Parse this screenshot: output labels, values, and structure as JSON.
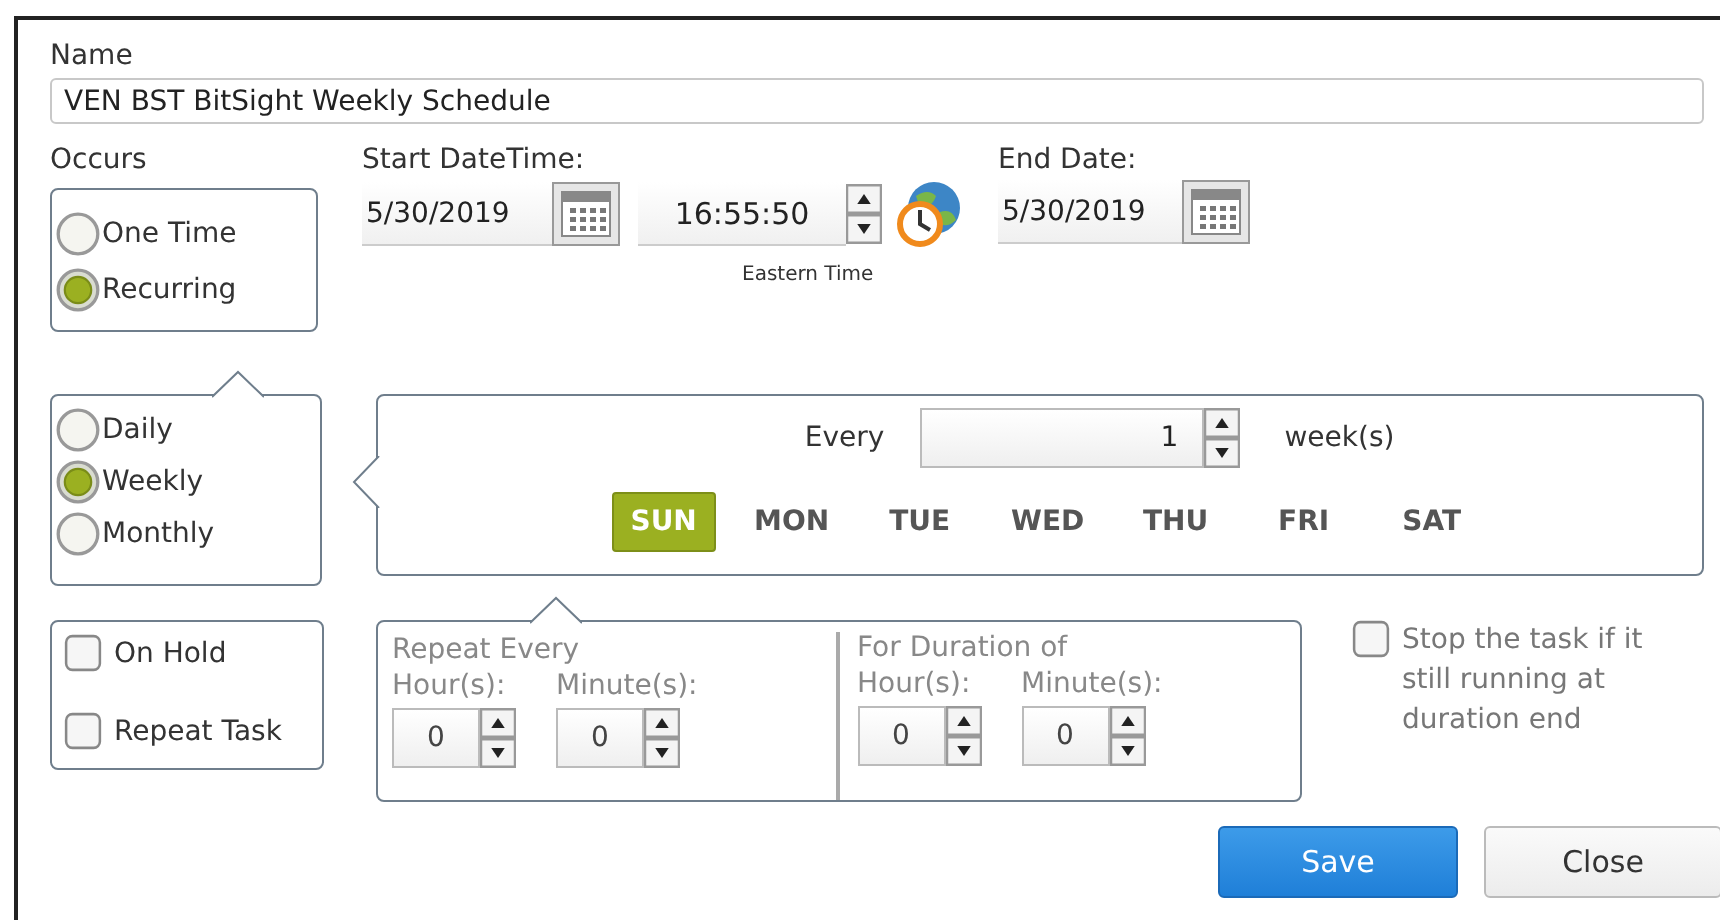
{
  "name": {
    "label": "Name",
    "value": "VEN BST BitSight Weekly Schedule"
  },
  "occurs": {
    "label": "Occurs",
    "options": [
      {
        "label": "One Time",
        "selected": false
      },
      {
        "label": "Recurring",
        "selected": true
      }
    ]
  },
  "start": {
    "label": "Start DateTime:",
    "date": "5/30/2019",
    "time": "16:55:50",
    "timezone": "Eastern Time"
  },
  "end": {
    "label": "End Date:",
    "date": "5/30/2019"
  },
  "frequency": [
    {
      "label": "Daily",
      "selected": false
    },
    {
      "label": "Weekly",
      "selected": true
    },
    {
      "label": "Monthly",
      "selected": false
    }
  ],
  "interval": {
    "label": "Every",
    "value": "1",
    "unit": "week(s)"
  },
  "days": [
    {
      "label": "SUN",
      "selected": true
    },
    {
      "label": "MON",
      "selected": false
    },
    {
      "label": "TUE",
      "selected": false
    },
    {
      "label": "WED",
      "selected": false
    },
    {
      "label": "THU",
      "selected": false
    },
    {
      "label": "FRI",
      "selected": false
    },
    {
      "label": "SAT",
      "selected": false
    }
  ],
  "options": [
    {
      "label": "On Hold",
      "checked": false
    },
    {
      "label": "Repeat Task",
      "checked": false
    }
  ],
  "repeat": {
    "disabled": true,
    "groups": [
      {
        "title": "Repeat Every",
        "fields": [
          {
            "label": "Hour(s):",
            "value": "0"
          },
          {
            "label": "Minute(s):",
            "value": "0"
          }
        ]
      },
      {
        "title": "For Duration of",
        "fields": [
          {
            "label": "Hour(s):",
            "value": "0"
          },
          {
            "label": "Minute(s):",
            "value": "0"
          }
        ]
      }
    ]
  },
  "stop": {
    "label": "Stop the task if it still running at duration end",
    "checked": false,
    "disabled": true
  },
  "buttons": [
    {
      "label": "Save",
      "kind": "primary"
    },
    {
      "label": "Close",
      "kind": "secondary"
    }
  ]
}
